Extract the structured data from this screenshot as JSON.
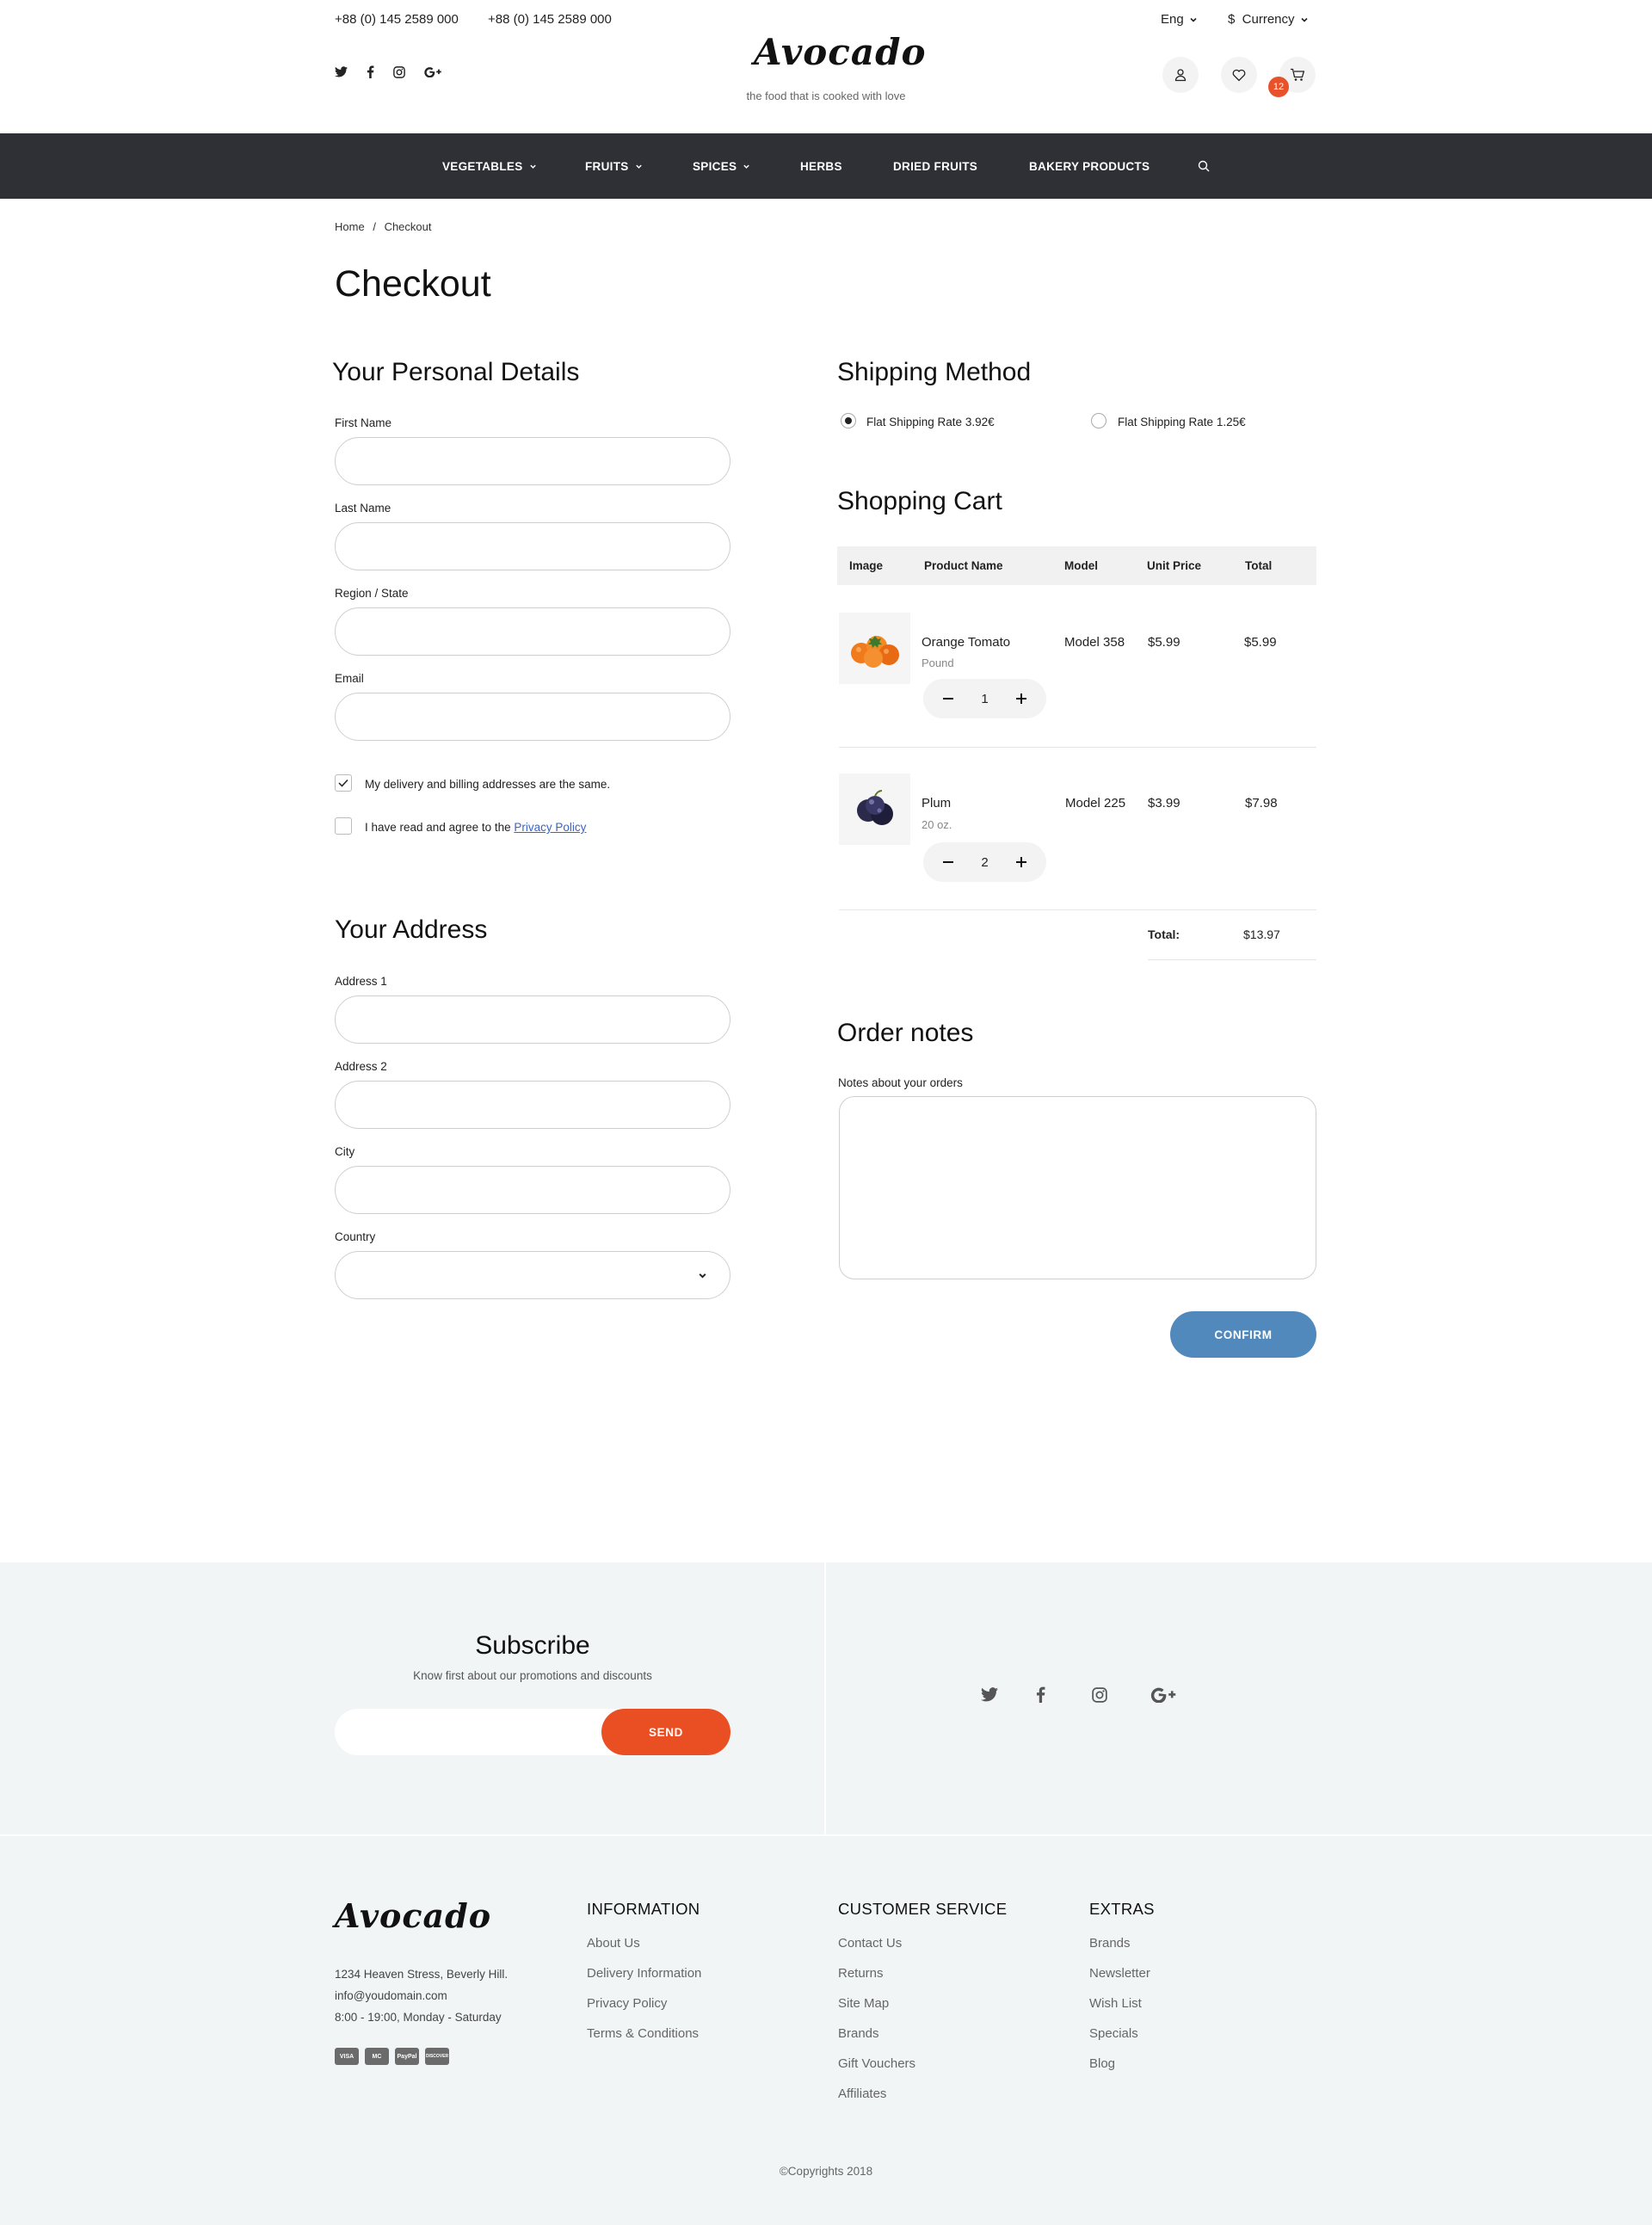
{
  "header": {
    "phone1": "+88 (0) 145 2589 000",
    "phone2": "+88 (0) 145 2589 000",
    "language": "Eng",
    "currency": "$  Currency",
    "logo": "Avocado",
    "tagline": "the food that is cooked with love",
    "cart_count": "12"
  },
  "nav": {
    "items": [
      {
        "label": "VEGETABLES"
      },
      {
        "label": "FRUITS"
      },
      {
        "label": "SPICES"
      },
      {
        "label": "HERBS"
      },
      {
        "label": "DRIED FRUITS"
      },
      {
        "label": "BAKERY PRODUCTS"
      }
    ]
  },
  "breadcrumb": {
    "home": "Home",
    "sep": "/",
    "current": "Checkout"
  },
  "page_title": "Checkout",
  "personal": {
    "title": "Your Personal Details",
    "first_name": "First Name",
    "last_name": "Last Name",
    "region": "Region / State",
    "email": "Email",
    "same_address": "My delivery and billing addresses are the same.",
    "agree_prefix": "I have read and agree to the ",
    "agree_link": "Privacy Policy"
  },
  "address": {
    "title": "Your Address",
    "address1": "Address 1",
    "address2": "Address 2",
    "city": "City",
    "country": "Country"
  },
  "shipping": {
    "title": "Shipping Method",
    "option1": "Flat Shipping Rate 3.92€",
    "option2": "Flat Shipping Rate 1.25€"
  },
  "cart": {
    "title": "Shopping Cart",
    "columns": [
      "Image",
      "Product Name",
      "Model",
      "Unit Price",
      "Total"
    ],
    "items": [
      {
        "name": "Orange Tomato",
        "unit": "Pound",
        "model": "Model 358",
        "price": "$5.99",
        "total": "$5.99",
        "qty": "1"
      },
      {
        "name": "Plum",
        "unit": "20 oz.",
        "model": "Model 225",
        "price": "$3.99",
        "total": "$7.98",
        "qty": "2"
      }
    ],
    "total_label": "Total:",
    "total_value": "$13.97"
  },
  "notes": {
    "title": "Order notes",
    "label": "Notes about your orders"
  },
  "confirm": "CONFIRM",
  "subscribe": {
    "title": "Subscribe",
    "desc": "Know first about our promotions and discounts",
    "send": "SEND"
  },
  "footer": {
    "logo": "Avocado",
    "address": "1234 Heaven Stress, Beverly Hill.",
    "email": "info@youdomain.com",
    "hours": "8:00 - 19:00, Monday - Saturday",
    "cards": [
      "VISA",
      "MC",
      "PayPal",
      "DISCOVER"
    ],
    "information": {
      "title": "INFORMATION",
      "links": [
        "About Us",
        "Delivery Information",
        "Privacy Policy",
        "Terms & Conditions"
      ]
    },
    "customer_service": {
      "title": "CUSTOMER SERVICE",
      "links": [
        "Contact Us",
        "Returns",
        "Site Map",
        "Brands",
        "Gift Vouchers",
        "Affiliates"
      ]
    },
    "extras": {
      "title": "EXTRAS",
      "links": [
        "Brands",
        "Newsletter",
        "Wish List",
        "Specials",
        "Blog"
      ]
    },
    "copyright": "©Copyrights 2018"
  },
  "colors": {
    "nav_bg": "#2f3036",
    "confirm": "#5289bd",
    "send": "#ea4f24",
    "badge": "#e8522a",
    "band_bg": "#f1f5f6"
  },
  "icons": [
    "twitter-icon",
    "facebook-icon",
    "instagram-icon",
    "google-plus-icon",
    "user-icon",
    "heart-icon",
    "cart-icon",
    "search-icon",
    "chevron-down-icon",
    "check-icon",
    "minus-icon",
    "plus-icon"
  ]
}
